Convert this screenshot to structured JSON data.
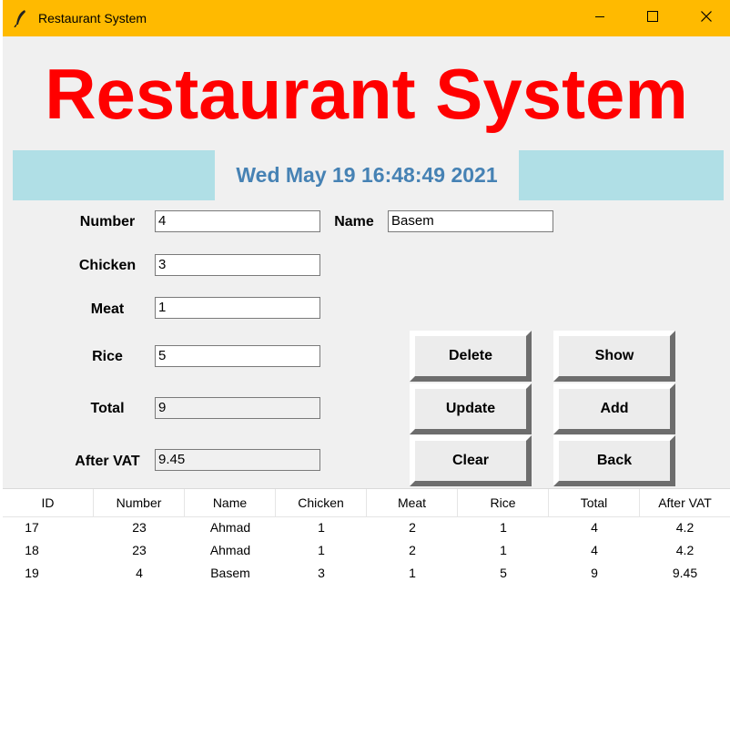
{
  "window": {
    "title": "Restaurant System",
    "controls": [
      "minimize-icon",
      "maximize-icon",
      "close-icon"
    ]
  },
  "heading": "Restaurant System",
  "clock": "Wed May 19 16:48:49 2021",
  "form": {
    "number": {
      "label": "Number",
      "value": "4"
    },
    "name": {
      "label": "Name",
      "value": "Basem"
    },
    "chicken": {
      "label": "Chicken",
      "value": "3"
    },
    "meat": {
      "label": "Meat",
      "value": "1"
    },
    "rice": {
      "label": "Rice",
      "value": "5"
    },
    "total": {
      "label": "Total",
      "value": "9"
    },
    "after_vat": {
      "label": "After VAT",
      "value": "9.45"
    }
  },
  "buttons": {
    "delete": "Delete",
    "show": "Show",
    "update": "Update",
    "add": "Add",
    "clear": "Clear",
    "back": "Back"
  },
  "table": {
    "columns": [
      "ID",
      "Number",
      "Name",
      "Chicken",
      "Meat",
      "Rice",
      "Total",
      "After VAT"
    ],
    "rows": [
      [
        "17",
        "23",
        "Ahmad",
        "1",
        "2",
        "1",
        "4",
        "4.2"
      ],
      [
        "18",
        "23",
        "Ahmad",
        "1",
        "2",
        "1",
        "4",
        "4.2"
      ],
      [
        "19",
        "4",
        "Basem",
        "3",
        "1",
        "5",
        "9",
        "9.45"
      ]
    ]
  },
  "colors": {
    "titlebar": "#ffba00",
    "heading": "#ff0000",
    "clock_text": "#4682b4",
    "clock_bar": "#b0dfe6"
  }
}
